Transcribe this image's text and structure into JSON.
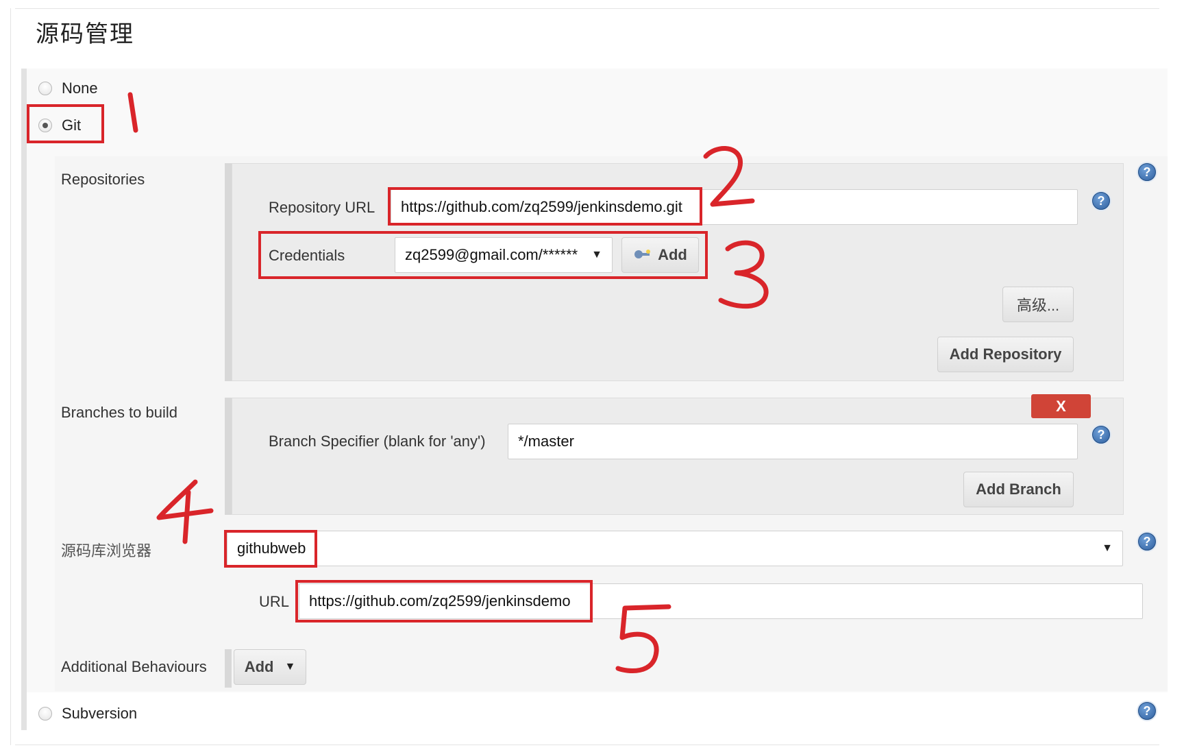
{
  "section": {
    "title": "源码管理"
  },
  "scm_options": {
    "none": "None",
    "git": "Git",
    "subversion": "Subversion"
  },
  "repositories": {
    "label": "Repositories",
    "url_label": "Repository URL",
    "url_value": "https://github.com/zq2599/jenkinsdemo.git",
    "credentials_label": "Credentials",
    "credentials_value": "zq2599@gmail.com/******",
    "add_label": "Add",
    "advanced_label": "高级...",
    "add_repository_label": "Add Repository"
  },
  "branches": {
    "label": "Branches to build",
    "specifier_label": "Branch Specifier (blank for 'any')",
    "specifier_value": "*/master",
    "delete_label": "X",
    "add_branch_label": "Add Branch"
  },
  "browser": {
    "label": "源码库浏览器",
    "value": "githubweb",
    "url_label": "URL",
    "url_value": "https://github.com/zq2599/jenkinsdemo"
  },
  "behaviours": {
    "label": "Additional Behaviours",
    "add_label": "Add"
  },
  "help_icon": "?",
  "annotations": {
    "one": "1",
    "two": "2",
    "three": "3",
    "four": "4",
    "five": "5"
  },
  "colors": {
    "annotation_red": "#d9252a",
    "help_blue": "#2f5f9e",
    "danger_red": "#d04437"
  }
}
